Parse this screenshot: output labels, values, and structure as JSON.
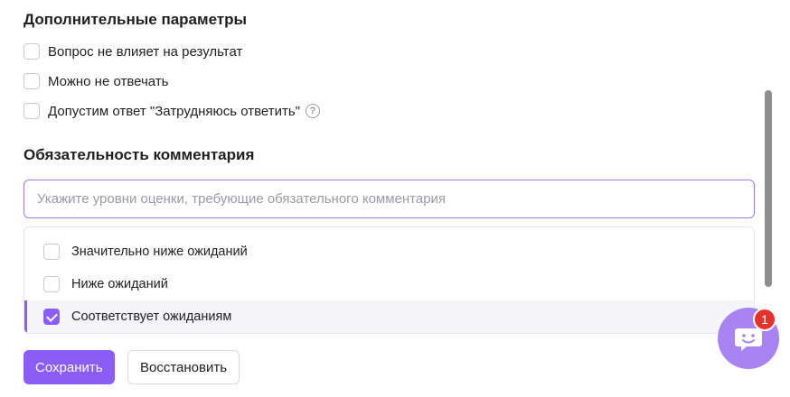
{
  "colors": {
    "accent": "#8b5cf6",
    "badge": "#e5322d",
    "chat_fab": "#a784f2"
  },
  "additional_params": {
    "title": "Дополнительные параметры",
    "options": [
      {
        "label": "Вопрос не влияет на результат",
        "checked": false
      },
      {
        "label": "Можно не отвечать",
        "checked": false
      },
      {
        "label": "Допустим ответ \"Затрудняюсь ответить\"",
        "checked": false,
        "help_icon": "question-circle-icon"
      }
    ],
    "help_glyph": "?"
  },
  "comment_requirement": {
    "title": "Обязательность комментария",
    "search": {
      "placeholder": "Укажите уровни оценки, требующие обязательного комментария",
      "value": ""
    },
    "dropdown_items": [
      {
        "label": "Значительно ниже ожиданий",
        "checked": false
      },
      {
        "label": "Ниже ожиданий",
        "checked": false
      },
      {
        "label": "Соответствует ожиданиям",
        "checked": true
      }
    ]
  },
  "actions": {
    "save_label": "Сохранить",
    "restore_label": "Восстановить"
  },
  "chat_widget": {
    "icon": "chat-bubble-smile-icon",
    "badge_count": "1"
  }
}
